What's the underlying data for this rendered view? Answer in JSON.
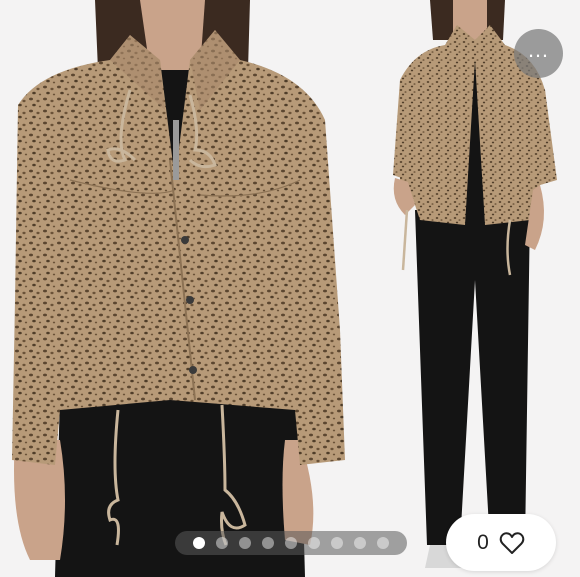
{
  "listing": {
    "like_count": "0",
    "photo_index": 1,
    "photo_total": 9
  },
  "icons": {
    "more": "more-dots-icon",
    "like": "heart-outline-icon"
  },
  "colors": {
    "background": "#f4f3f3",
    "jacket": "#b79a78",
    "spots": "#5b4630",
    "pants": "#141414"
  }
}
